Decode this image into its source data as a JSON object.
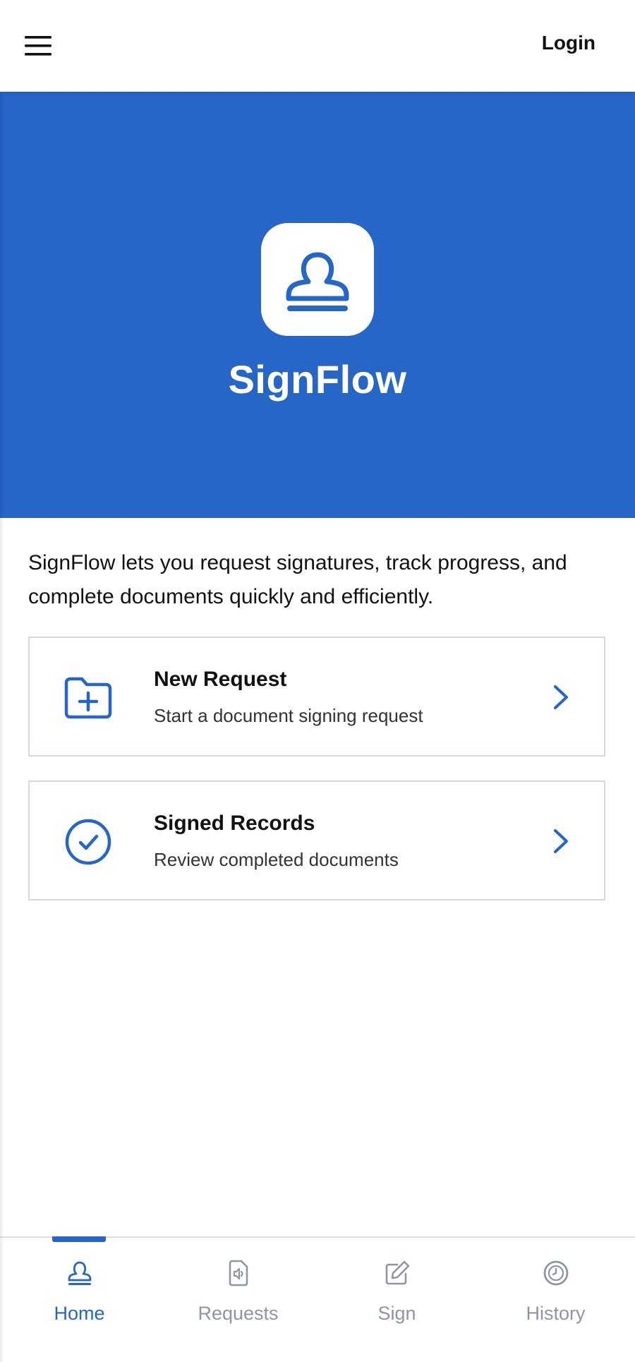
{
  "header": {
    "menu_icon": "hamburger-menu-icon",
    "login_label": "Login"
  },
  "hero": {
    "logo_icon": "stamp-icon",
    "app_name": "SignFlow"
  },
  "intro": {
    "text": "SignFlow lets you request signatures, track progress, and complete documents quickly and efficiently."
  },
  "actions": [
    {
      "icon": "folder-plus-icon",
      "title": "New Request",
      "subtitle": "Start a document signing request",
      "chevron": "chevron-right-icon"
    },
    {
      "icon": "check-circle-icon",
      "title": "Signed Records",
      "subtitle": "Review completed documents",
      "chevron": "chevron-right-icon"
    }
  ],
  "bottom_nav": {
    "active": "Home",
    "items": [
      {
        "label": "Home",
        "icon": "stamp-icon"
      },
      {
        "label": "Requests",
        "icon": "document-audio-icon"
      },
      {
        "label": "Sign",
        "icon": "pen-edit-icon"
      },
      {
        "label": "History",
        "icon": "clock-circle-icon"
      }
    ]
  },
  "colors": {
    "primary": "#2566c6",
    "inactive": "#8e96a4",
    "border": "#d4d9e8"
  }
}
